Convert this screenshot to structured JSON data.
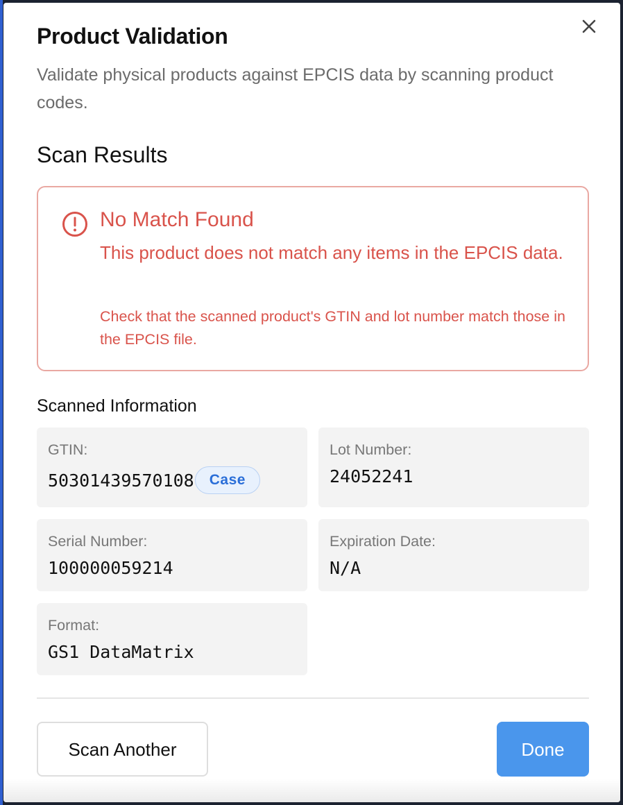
{
  "dialog": {
    "title": "Product Validation",
    "subtitle": "Validate physical products against EPCIS data by scanning product codes.",
    "close_icon": "close-icon"
  },
  "results": {
    "heading": "Scan Results",
    "alert": {
      "icon": "alert-circle-icon",
      "title": "No Match Found",
      "message": "This product does not match any items in the EPCIS data.",
      "hint": "Check that the scanned product's GTIN and lot number match those in the EPCIS file.",
      "color": "#d9534b",
      "border_color": "#e9a8a2"
    }
  },
  "scanned": {
    "heading": "Scanned Information",
    "gtin": {
      "label": "GTIN:",
      "value": "50301439570108",
      "badge": "Case"
    },
    "lot": {
      "label": "Lot Number:",
      "value": "24052241"
    },
    "serial": {
      "label": "Serial Number:",
      "value": "100000059214"
    },
    "expiration": {
      "label": "Expiration Date:",
      "value": "N/A"
    },
    "format": {
      "label": "Format:",
      "value": "GS1 DataMatrix"
    }
  },
  "actions": {
    "scan_another": "Scan Another",
    "done": "Done",
    "primary_color": "#4a96ec"
  }
}
